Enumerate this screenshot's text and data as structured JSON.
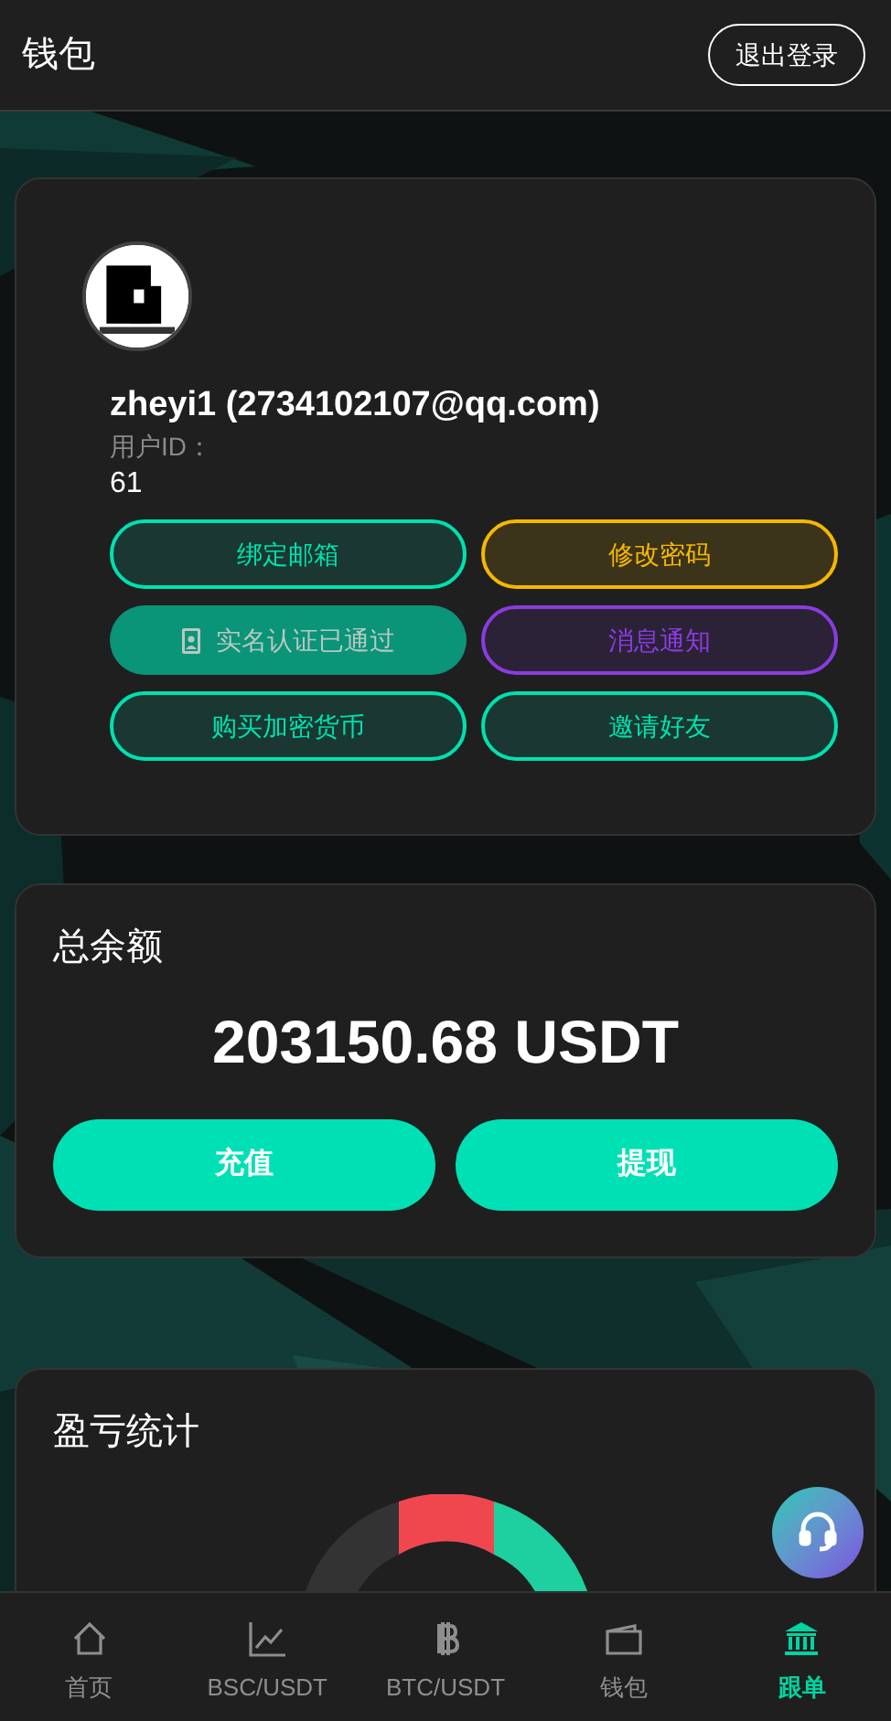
{
  "header": {
    "title": "钱包",
    "logout_button": "退出登录"
  },
  "profile": {
    "name": "zheyi1 (2734102107@qq.com)",
    "id_label": "用户ID：",
    "id_value": "61",
    "actions": [
      {
        "label": "绑定邮箱",
        "kind": "outline",
        "color": "#00e0b0"
      },
      {
        "label": "修改密码",
        "kind": "outline",
        "color": "#f5b800"
      },
      {
        "label": "实名认证已通过",
        "kind": "verified",
        "color": "#0a9478"
      },
      {
        "label": "消息通知",
        "kind": "outline",
        "color": "#8a3ce0"
      },
      {
        "label": "购买加密货币",
        "kind": "outline",
        "color": "#00e0b0"
      },
      {
        "label": "邀请好友",
        "kind": "outline",
        "color": "#00e0b0"
      }
    ]
  },
  "balance": {
    "title": "总余额",
    "amount": "203150.68 USDT",
    "buttons": [
      "充值",
      "提现"
    ]
  },
  "pnl": {
    "title": "盈亏统计"
  },
  "bottom_nav": [
    {
      "label": "首页",
      "selected": false
    },
    {
      "label": "BSC/USDT",
      "selected": false
    },
    {
      "label": "BTC/USDT",
      "selected": false
    },
    {
      "label": "钱包",
      "selected": false
    },
    {
      "label": "跟单",
      "selected": true
    }
  ]
}
